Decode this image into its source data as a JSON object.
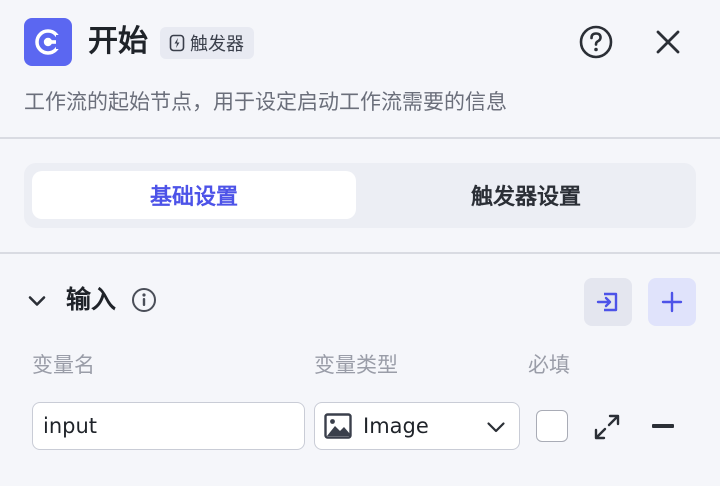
{
  "header": {
    "title": "开始",
    "trigger_badge": "触发器",
    "description": "工作流的起始节点，用于设定启动工作流需要的信息",
    "icon": "start-node-icon",
    "accent": "#5b67f1"
  },
  "tabs": [
    {
      "label": "基础设置",
      "active": true
    },
    {
      "label": "触发器设置",
      "active": false
    }
  ],
  "input_section": {
    "title": "输入",
    "columns": {
      "name": "变量名",
      "type": "变量类型",
      "required": "必填"
    },
    "rows": [
      {
        "name": "input",
        "type": "Image",
        "required": false
      }
    ]
  },
  "colors": {
    "active_tab_text": "#4d53e8",
    "add_button_bg": "#e0e3fb"
  }
}
